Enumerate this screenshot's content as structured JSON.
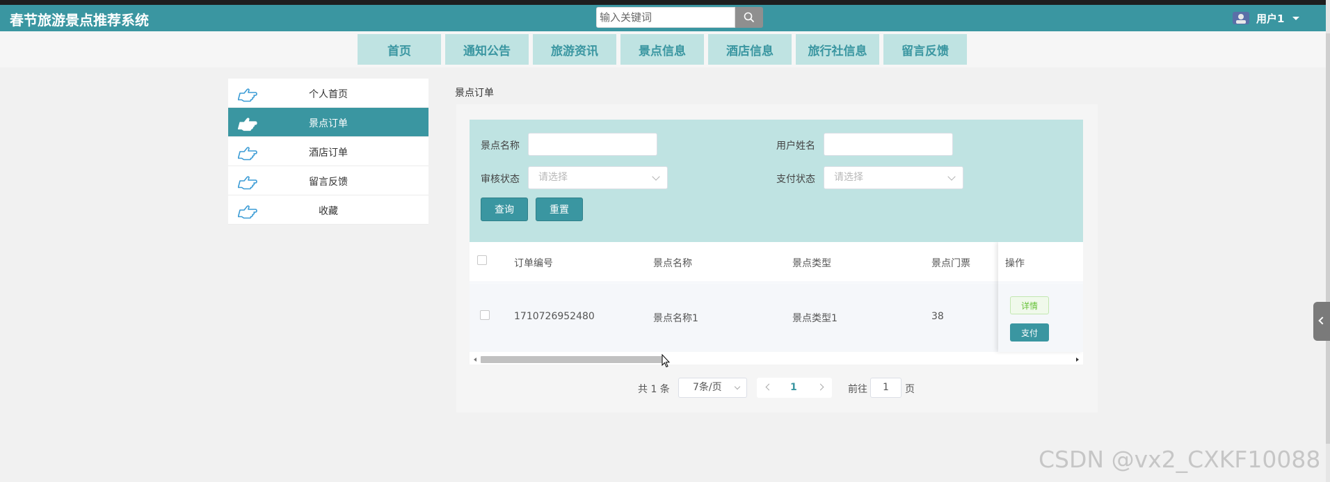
{
  "app": {
    "title": "春节旅游景点推荐系统"
  },
  "search": {
    "placeholder": "输入关键词"
  },
  "user": {
    "name": "用户1"
  },
  "nav": {
    "items": [
      {
        "label": "首页"
      },
      {
        "label": "通知公告"
      },
      {
        "label": "旅游资讯"
      },
      {
        "label": "景点信息"
      },
      {
        "label": "酒店信息"
      },
      {
        "label": "旅行社信息"
      },
      {
        "label": "留言反馈"
      }
    ]
  },
  "sidebar": {
    "items": [
      {
        "label": "个人首页",
        "active": false
      },
      {
        "label": "景点订单",
        "active": true
      },
      {
        "label": "酒店订单",
        "active": false
      },
      {
        "label": "留言反馈",
        "active": false
      },
      {
        "label": "收藏",
        "active": false
      }
    ]
  },
  "breadcrumb": {
    "current": "景点订单"
  },
  "filters": {
    "spot_name_label": "景点名称",
    "user_name_label": "用户姓名",
    "review_status_label": "审核状态",
    "review_status_placeholder": "请选择",
    "pay_status_label": "支付状态",
    "pay_status_placeholder": "请选择",
    "query_button": "查询",
    "reset_button": "重置"
  },
  "table": {
    "columns": [
      "订单编号",
      "景点名称",
      "景点类型",
      "景点门票",
      "操作"
    ],
    "rows": [
      {
        "order_no": "1710726952480",
        "spot_name": "景点名称1",
        "spot_type": "景点类型1",
        "ticket": "38"
      }
    ],
    "detail_button": "详情",
    "pay_button": "支付",
    "scroll_position": 0.24
  },
  "pagination": {
    "total_text": "共 1 条",
    "page_size": "7条/页",
    "current_page": "1",
    "goto_prefix": "前往",
    "goto_value": "1",
    "goto_suffix": "页"
  },
  "watermark": {
    "text": "CSDN @vx2_CXKF10088"
  },
  "colors": {
    "primary": "#3a96a1",
    "nav_bg": "#bfe3e2",
    "filter_bg": "#bfe3e2"
  }
}
